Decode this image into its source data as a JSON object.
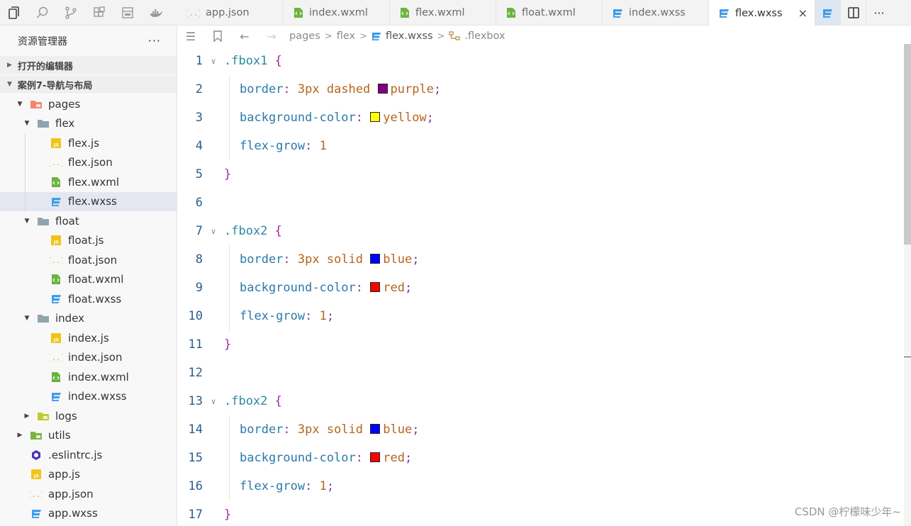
{
  "tabs": [
    {
      "label": "app.json",
      "icon": "json-icon",
      "active": false
    },
    {
      "label": "index.wxml",
      "icon": "wxml-icon",
      "active": false
    },
    {
      "label": "flex.wxml",
      "icon": "wxml-icon",
      "active": false
    },
    {
      "label": "float.wxml",
      "icon": "wxml-icon",
      "active": false
    },
    {
      "label": "index.wxss",
      "icon": "wxss-icon",
      "active": false
    },
    {
      "label": "flex.wxss",
      "icon": "wxss-icon",
      "active": true,
      "close": "×"
    }
  ],
  "sidebar": {
    "title": "资源管理器",
    "more": "···",
    "open_editors": "打开的编辑器",
    "project": "案例7-导航与布局",
    "tree": [
      {
        "label": "pages",
        "depth": 0,
        "kind": "folder-pages",
        "arrow": "▼"
      },
      {
        "label": "flex",
        "depth": 1,
        "kind": "folder",
        "arrow": "▼"
      },
      {
        "label": "flex.js",
        "depth": 2,
        "kind": "js"
      },
      {
        "label": "flex.json",
        "depth": 2,
        "kind": "json"
      },
      {
        "label": "flex.wxml",
        "depth": 2,
        "kind": "wxml"
      },
      {
        "label": "flex.wxss",
        "depth": 2,
        "kind": "wxss",
        "selected": true
      },
      {
        "label": "float",
        "depth": 1,
        "kind": "folder",
        "arrow": "▼"
      },
      {
        "label": "float.js",
        "depth": 2,
        "kind": "js"
      },
      {
        "label": "float.json",
        "depth": 2,
        "kind": "json"
      },
      {
        "label": "float.wxml",
        "depth": 2,
        "kind": "wxml"
      },
      {
        "label": "float.wxss",
        "depth": 2,
        "kind": "wxss"
      },
      {
        "label": "index",
        "depth": 1,
        "kind": "folder",
        "arrow": "▼"
      },
      {
        "label": "index.js",
        "depth": 2,
        "kind": "js"
      },
      {
        "label": "index.json",
        "depth": 2,
        "kind": "json"
      },
      {
        "label": "index.wxml",
        "depth": 2,
        "kind": "wxml"
      },
      {
        "label": "index.wxss",
        "depth": 2,
        "kind": "wxss"
      },
      {
        "label": "logs",
        "depth": 1,
        "kind": "folder-logs",
        "arrow": "▶"
      },
      {
        "label": "utils",
        "depth": 0,
        "kind": "folder-utils",
        "arrow": "▶"
      },
      {
        "label": ".eslintrc.js",
        "depth": 0,
        "kind": "eslint"
      },
      {
        "label": "app.js",
        "depth": 0,
        "kind": "js"
      },
      {
        "label": "app.json",
        "depth": 0,
        "kind": "json"
      },
      {
        "label": "app.wxss",
        "depth": 0,
        "kind": "wxss"
      }
    ]
  },
  "breadcrumb": {
    "parts": [
      "pages",
      "flex",
      "flex.wxss",
      ".flexbox"
    ],
    "separator": ">"
  },
  "editor": {
    "lines": [
      {
        "n": "1",
        "fold": true,
        "tokens": [
          {
            "t": ".fbox1",
            "c": "sel"
          },
          {
            "t": " "
          },
          {
            "t": "{",
            "c": "brace"
          }
        ]
      },
      {
        "n": "2",
        "indent": true,
        "tokens": [
          {
            "t": "border",
            "c": "prop"
          },
          {
            "t": ": ",
            "c": "punc"
          },
          {
            "t": "3px dashed ",
            "c": "val"
          },
          {
            "swatch": "#800080"
          },
          {
            "t": "purple",
            "c": "val"
          },
          {
            "t": ";",
            "c": "punc"
          }
        ]
      },
      {
        "n": "3",
        "indent": true,
        "tokens": [
          {
            "t": "background-color",
            "c": "prop"
          },
          {
            "t": ": ",
            "c": "punc"
          },
          {
            "swatch": "#ffff00"
          },
          {
            "t": "yellow",
            "c": "val"
          },
          {
            "t": ";",
            "c": "punc"
          }
        ]
      },
      {
        "n": "4",
        "indent": true,
        "tokens": [
          {
            "t": "flex-grow",
            "c": "prop"
          },
          {
            "t": ": ",
            "c": "punc"
          },
          {
            "t": "1",
            "c": "num"
          }
        ]
      },
      {
        "n": "5",
        "tokens": [
          {
            "t": "}",
            "c": "brace"
          }
        ]
      },
      {
        "n": "6",
        "tokens": []
      },
      {
        "n": "7",
        "fold": true,
        "tokens": [
          {
            "t": ".fbox2",
            "c": "sel"
          },
          {
            "t": " "
          },
          {
            "t": "{",
            "c": "brace"
          }
        ]
      },
      {
        "n": "8",
        "indent": true,
        "tokens": [
          {
            "t": "border",
            "c": "prop"
          },
          {
            "t": ": ",
            "c": "punc"
          },
          {
            "t": "3px solid ",
            "c": "val"
          },
          {
            "swatch": "#0000ff"
          },
          {
            "t": "blue",
            "c": "val"
          },
          {
            "t": ";",
            "c": "punc"
          }
        ]
      },
      {
        "n": "9",
        "indent": true,
        "tokens": [
          {
            "t": "background-color",
            "c": "prop"
          },
          {
            "t": ": ",
            "c": "punc"
          },
          {
            "swatch": "#ff0000"
          },
          {
            "t": "red",
            "c": "val"
          },
          {
            "t": ";",
            "c": "punc"
          }
        ]
      },
      {
        "n": "10",
        "indent": true,
        "tokens": [
          {
            "t": "flex-grow",
            "c": "prop"
          },
          {
            "t": ": ",
            "c": "punc"
          },
          {
            "t": "1",
            "c": "num"
          },
          {
            "t": ";",
            "c": "punc"
          }
        ]
      },
      {
        "n": "11",
        "tokens": [
          {
            "t": "}",
            "c": "brace"
          }
        ]
      },
      {
        "n": "12",
        "tokens": []
      },
      {
        "n": "13",
        "fold": true,
        "tokens": [
          {
            "t": ".fbox2",
            "c": "sel"
          },
          {
            "t": " "
          },
          {
            "t": "{",
            "c": "brace"
          }
        ]
      },
      {
        "n": "14",
        "indent": true,
        "tokens": [
          {
            "t": "border",
            "c": "prop"
          },
          {
            "t": ": ",
            "c": "punc"
          },
          {
            "t": "3px solid ",
            "c": "val"
          },
          {
            "swatch": "#0000ff"
          },
          {
            "t": "blue",
            "c": "val"
          },
          {
            "t": ";",
            "c": "punc"
          }
        ]
      },
      {
        "n": "15",
        "indent": true,
        "tokens": [
          {
            "t": "background-color",
            "c": "prop"
          },
          {
            "t": ": ",
            "c": "punc"
          },
          {
            "swatch": "#ff0000"
          },
          {
            "t": "red",
            "c": "val"
          },
          {
            "t": ";",
            "c": "punc"
          }
        ]
      },
      {
        "n": "16",
        "indent": true,
        "tokens": [
          {
            "t": "flex-grow",
            "c": "prop"
          },
          {
            "t": ": ",
            "c": "punc"
          },
          {
            "t": "1",
            "c": "num"
          },
          {
            "t": ";",
            "c": "punc"
          }
        ]
      },
      {
        "n": "17",
        "tokens": [
          {
            "t": "}",
            "c": "brace"
          }
        ]
      }
    ]
  },
  "watermark": "CSDN @柠檬味少年~",
  "colors": {
    "accent": "#3a8ee6",
    "wxss": "#3c9ae8",
    "wxml": "#6db33f",
    "json": "#e6a23c",
    "js": "#f0c419"
  }
}
